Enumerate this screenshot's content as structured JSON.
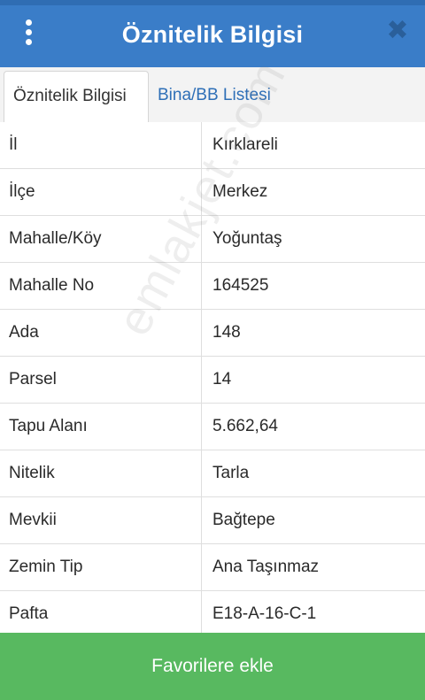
{
  "header": {
    "title": "Öznitelik Bilgisi",
    "menu_icon": "menu-dots-icon",
    "close_icon": "close-icon"
  },
  "tabs": [
    {
      "label": "Öznitelik Bilgisi",
      "active": true
    },
    {
      "label": "Bina/BB Listesi",
      "active": false
    }
  ],
  "rows": [
    {
      "key": "İl",
      "value": "Kırklareli"
    },
    {
      "key": "İlçe",
      "value": "Merkez"
    },
    {
      "key": "Mahalle/Köy",
      "value": "Yoğuntaş"
    },
    {
      "key": "Mahalle No",
      "value": "164525"
    },
    {
      "key": "Ada",
      "value": "148"
    },
    {
      "key": "Parsel",
      "value": "14"
    },
    {
      "key": "Tapu Alanı",
      "value": "5.662,64"
    },
    {
      "key": "Nitelik",
      "value": "Tarla"
    },
    {
      "key": "Mevkii",
      "value": "Bağtepe"
    },
    {
      "key": "Zemin Tip",
      "value": "Ana Taşınmaz"
    },
    {
      "key": "Pafta",
      "value": "E18-A-16-C-1"
    }
  ],
  "watermark": "emlakjet.com",
  "footer": {
    "favorite_label": "Favorilere ekle"
  },
  "colors": {
    "header": "#3a7dc8",
    "tab_link": "#2e6fb7",
    "button": "#58b960"
  }
}
